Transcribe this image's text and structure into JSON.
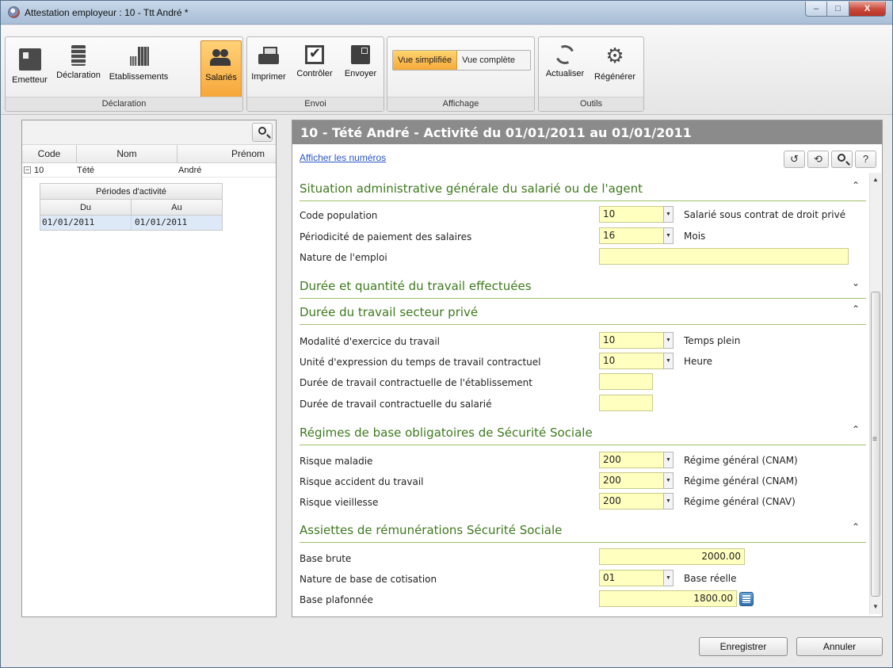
{
  "window": {
    "title": "Attestation employeur : 10 - Ttt André *",
    "controls": {
      "minimize": "–",
      "maximize": "□",
      "close": "X"
    }
  },
  "ribbon": {
    "groups": [
      {
        "label": "Déclaration",
        "buttons": [
          "Emetteur",
          "Déclaration",
          "Etablissements",
          "Salariés"
        ],
        "active": "Salariés"
      },
      {
        "label": "Envoi",
        "buttons": [
          "Imprimer",
          "Contrôler",
          "Envoyer"
        ]
      },
      {
        "label": "Affichage",
        "toggle": [
          "Vue simplifiée",
          "Vue complète"
        ],
        "active": "Vue simplifiée"
      },
      {
        "label": "Outils",
        "buttons": [
          "Actualiser",
          "Régénérer"
        ]
      }
    ],
    "accent_color": "#f7a73a"
  },
  "employees": {
    "columns": [
      "Code",
      "Nom",
      "Prénom"
    ],
    "rows": [
      {
        "code": "10",
        "nom": "Tété",
        "prenom": "André",
        "expander": "−"
      }
    ],
    "periods": {
      "title": "Périodes d'activité",
      "columns": [
        "Du",
        "Au"
      ],
      "rows": [
        {
          "du": "01/01/2011",
          "au": "01/01/2011"
        }
      ]
    }
  },
  "detail": {
    "title": "10 - Tété André - Activité du 01/01/2011 au 01/01/2011",
    "show_numbers_link": "Afficher les numéros",
    "sections": [
      {
        "title": "Situation administrative générale du salarié ou de l'agent",
        "collapsed": false,
        "fields": [
          {
            "label": "Code population",
            "value": "10",
            "desc": "Salarié sous contrat de droit privé"
          },
          {
            "label": "Périodicité de paiement des salaires",
            "value": "16",
            "desc": "Mois"
          },
          {
            "label": "Nature de l'emploi",
            "value": ""
          }
        ]
      },
      {
        "title": "Durée et quantité du travail effectuées",
        "collapsed": true
      },
      {
        "title": "Durée du travail secteur privé",
        "collapsed": false,
        "fields": [
          {
            "label": "Modalité d'exercice du travail",
            "value": "10",
            "desc": "Temps plein"
          },
          {
            "label": "Unité d'expression du temps de travail contractuel",
            "value": "10",
            "desc": "Heure"
          },
          {
            "label": "Durée de travail contractuelle de l'établissement",
            "value": ""
          },
          {
            "label": "Durée de travail contractuelle du salarié",
            "value": ""
          }
        ]
      },
      {
        "title": "Régimes de base obligatoires de Sécurité Sociale",
        "collapsed": false,
        "fields": [
          {
            "label": "Risque maladie",
            "value": "200",
            "desc": "Régime général (CNAM)"
          },
          {
            "label": "Risque accident du travail",
            "value": "200",
            "desc": "Régime général (CNAM)"
          },
          {
            "label": "Risque vieillesse",
            "value": "200",
            "desc": "Régime général (CNAV)"
          }
        ]
      },
      {
        "title": "Assiettes de rémunérations Sécurité Sociale",
        "collapsed": false,
        "fields": [
          {
            "label": "Base brute",
            "value": "2000.00"
          },
          {
            "label": "Nature de base de cotisation",
            "value": "01",
            "desc": "Base réelle"
          },
          {
            "label": "Base plafonnée",
            "value": "1800.00"
          }
        ]
      }
    ],
    "chevrons": {
      "expanded": "⌃",
      "collapsed": "⌄"
    }
  },
  "footer": {
    "save": "Enregistrer",
    "cancel": "Annuler"
  },
  "colors": {
    "section_title": "#3e7a1e",
    "section_rule": "#9ec06a",
    "input_bg": "#ffffc0",
    "header_bar": "#8b8b8b"
  }
}
